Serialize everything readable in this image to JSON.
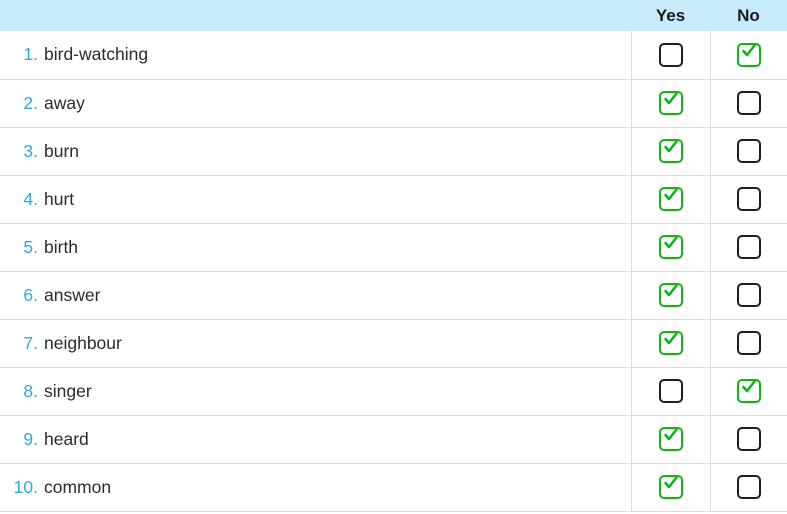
{
  "table": {
    "header": {
      "word_column_label": "",
      "yes_label": "Yes",
      "no_label": "No"
    },
    "colors": {
      "header_background": "#c6ebfb",
      "number_blue": "#2ea8e8",
      "checked_green": "#13b413",
      "unchecked_border": "#1f1f1f",
      "row_divider": "#dcdcdc",
      "word_text": "#2b2b2b"
    },
    "rows": [
      {
        "number": "1.",
        "word": "bird-watching",
        "yes_state": "unchecked",
        "no_state": "checked",
        "yes_icon": "checkbox-empty-icon",
        "no_icon": "checkbox-checked-icon"
      },
      {
        "number": "2.",
        "word": "away",
        "yes_state": "checked",
        "no_state": "unchecked",
        "yes_icon": "checkbox-checked-icon",
        "no_icon": "checkbox-empty-icon"
      },
      {
        "number": "3.",
        "word": "burn",
        "yes_state": "checked",
        "no_state": "unchecked",
        "yes_icon": "checkbox-checked-icon",
        "no_icon": "checkbox-empty-icon"
      },
      {
        "number": "4.",
        "word": "hurt",
        "yes_state": "checked",
        "no_state": "unchecked",
        "yes_icon": "checkbox-checked-icon",
        "no_icon": "checkbox-empty-icon"
      },
      {
        "number": "5.",
        "word": "birth",
        "yes_state": "checked",
        "no_state": "unchecked",
        "yes_icon": "checkbox-checked-icon",
        "no_icon": "checkbox-empty-icon"
      },
      {
        "number": "6.",
        "word": "answer",
        "yes_state": "checked",
        "no_state": "unchecked",
        "yes_icon": "checkbox-checked-icon",
        "no_icon": "checkbox-empty-icon"
      },
      {
        "number": "7.",
        "word": "neighbour",
        "yes_state": "checked",
        "no_state": "unchecked",
        "yes_icon": "checkbox-checked-icon",
        "no_icon": "checkbox-empty-icon"
      },
      {
        "number": "8.",
        "word": "singer",
        "yes_state": "unchecked",
        "no_state": "checked",
        "yes_icon": "checkbox-empty-icon",
        "no_icon": "checkbox-checked-icon"
      },
      {
        "number": "9.",
        "word": "heard",
        "yes_state": "checked",
        "no_state": "unchecked",
        "yes_icon": "checkbox-checked-icon",
        "no_icon": "checkbox-empty-icon"
      },
      {
        "number": "10.",
        "word": "common",
        "yes_state": "checked",
        "no_state": "unchecked",
        "yes_icon": "checkbox-checked-icon",
        "no_icon": "checkbox-empty-icon"
      }
    ]
  }
}
